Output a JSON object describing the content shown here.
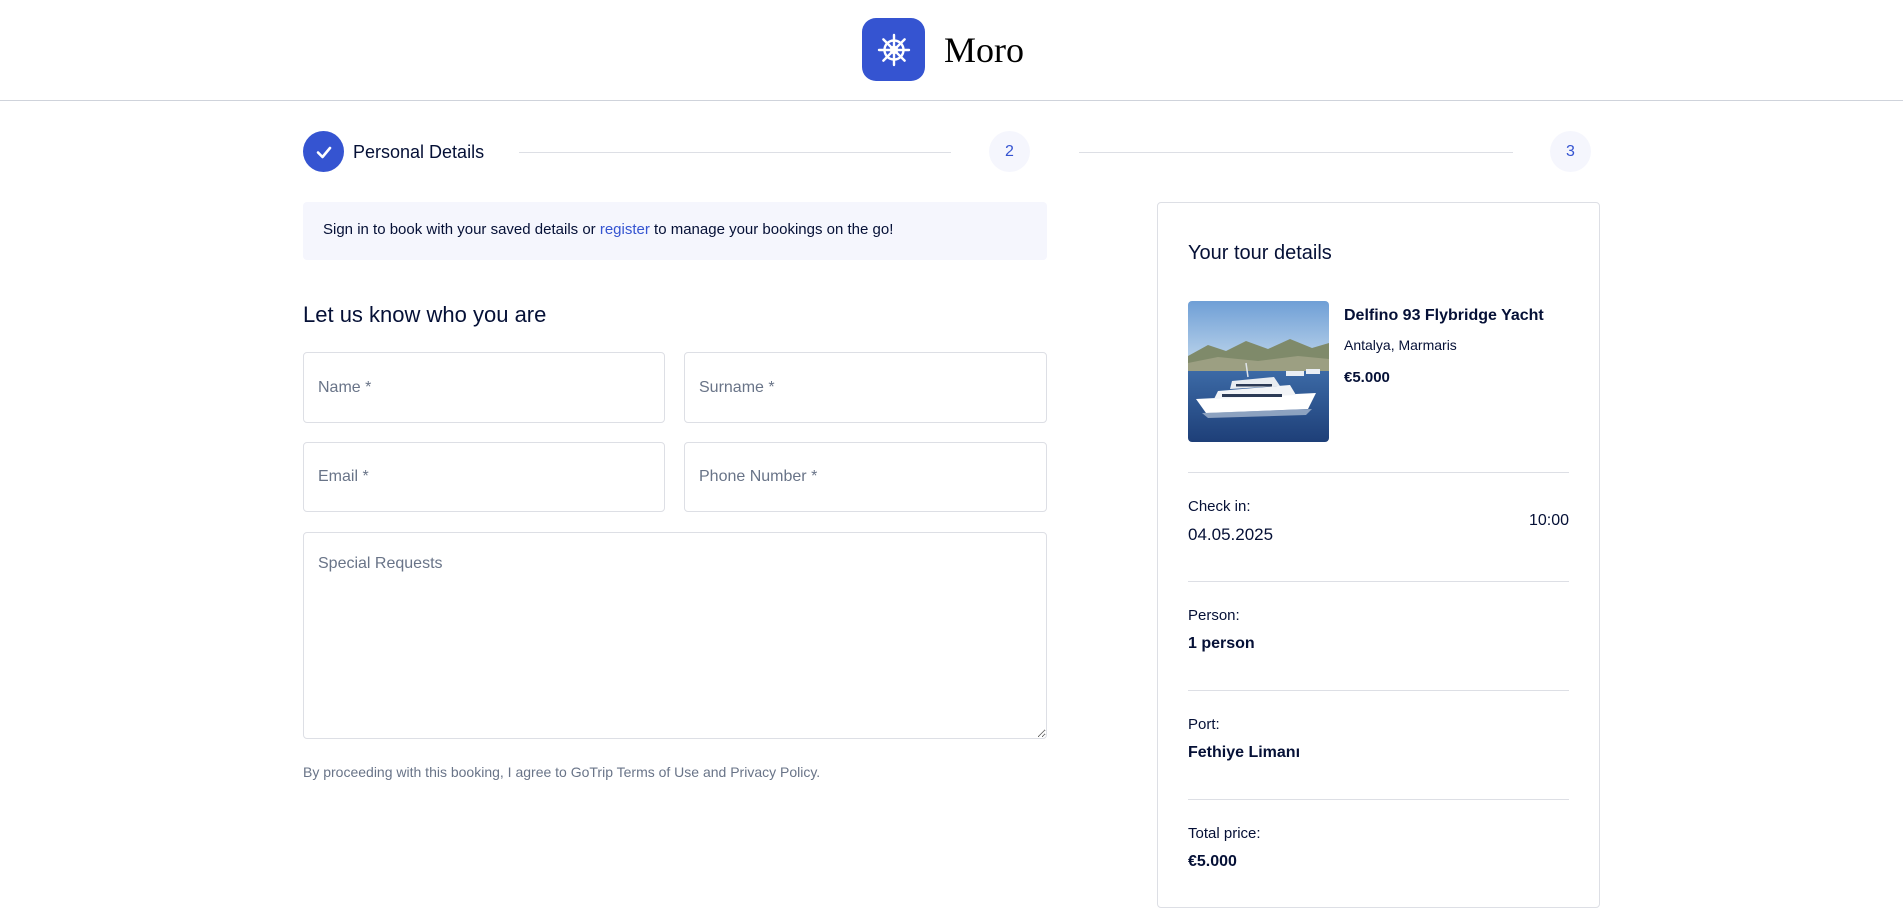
{
  "header": {
    "brand_name": "Moro",
    "logo_icon": "ship-wheel-icon",
    "accent_color": "#3554d1"
  },
  "stepper": {
    "step1_label": "Personal Details",
    "step2_number": "2",
    "step3_number": "3"
  },
  "signin": {
    "text_before": "Sign in to book with your saved details or ",
    "register_link": "register",
    "text_after": " to manage your bookings on the go!"
  },
  "form": {
    "title": "Let us know who you are",
    "name_placeholder": "Name *",
    "surname_placeholder": "Surname *",
    "email_placeholder": "Email *",
    "phone_placeholder": "Phone Number *",
    "requests_placeholder": "Special Requests",
    "agreement": "By proceeding with this booking, I agree to GoTrip Terms of Use and Privacy Policy."
  },
  "tour": {
    "card_title": "Your tour details",
    "name": "Delfino 93 Flybridge Yacht",
    "location": "Antalya, Marmaris",
    "price": "€5.000",
    "checkin_label": "Check in:",
    "checkin_date": "04.05.2025",
    "checkin_time": "10:00",
    "person_label": "Person:",
    "person_value": "1 person",
    "port_label": "Port:",
    "port_value": "Fethiye Limanı",
    "total_label": "Total price:",
    "total_value": "€5.000"
  }
}
